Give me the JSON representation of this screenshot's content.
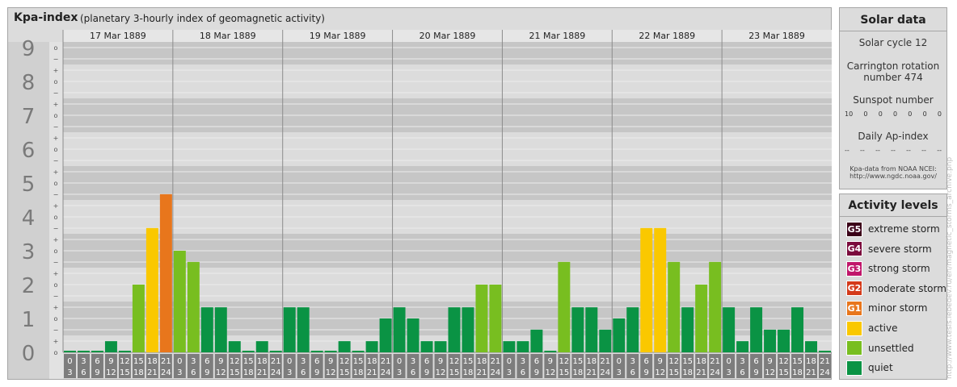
{
  "chart_data": {
    "type": "bar",
    "title": "Kpa-index",
    "subtitle": "(planetary 3-hourly index of geomagnetic activity)",
    "days": [
      "17 Mar 1889",
      "18 Mar 1889",
      "19 Mar 1889",
      "20 Mar 1889",
      "21 Mar 1889",
      "22 Mar 1889",
      "23 Mar 1889"
    ],
    "interval_starts": [
      "0",
      "3",
      "6",
      "9",
      "12",
      "15",
      "18",
      "21"
    ],
    "interval_ends": [
      "3",
      "6",
      "9",
      "12",
      "15",
      "18",
      "21",
      "24"
    ],
    "y_ticks": [
      "0",
      "1",
      "2",
      "3",
      "4",
      "5",
      "6",
      "7",
      "8",
      "9"
    ],
    "minor_marks": [
      "o",
      "+",
      "−"
    ],
    "ylim": [
      0,
      9.33
    ],
    "values": [
      [
        0.0,
        0.0,
        0.0,
        0.33,
        0.0,
        2.0,
        3.67,
        4.67
      ],
      [
        3.0,
        2.67,
        1.33,
        1.33,
        0.33,
        0.0,
        0.33,
        0.0
      ],
      [
        1.33,
        1.33,
        0.0,
        0.0,
        0.33,
        0.0,
        0.33,
        1.0
      ],
      [
        1.33,
        1.0,
        0.33,
        0.33,
        1.33,
        1.33,
        2.0,
        2.0
      ],
      [
        0.33,
        0.33,
        0.67,
        0.0,
        2.67,
        1.33,
        1.33,
        0.67
      ],
      [
        1.0,
        1.33,
        3.67,
        3.67,
        2.67,
        1.33,
        2.0,
        2.67
      ],
      [
        1.33,
        0.33,
        1.33,
        0.67,
        0.67,
        1.33,
        0.33,
        0.0
      ]
    ],
    "level_colors": {
      "quiet": "#0a9344",
      "unsettled": "#78be20",
      "active": "#fac800",
      "G1": "#e8761c",
      "G2": "#d43a1a",
      "G3": "#c0166a",
      "G4": "#7b0a3c",
      "G5": "#3b0018"
    }
  },
  "solar_data": {
    "title": "Solar data",
    "solar_cycle": "Solar cycle 12",
    "carrington_line1": "Carrington rotation",
    "carrington_line2": "number 474",
    "sunspot_label": "Sunspot number",
    "sunspot_values": [
      "10",
      "0",
      "0",
      "0",
      "0",
      "0",
      "0"
    ],
    "ap_label": "Daily Ap-index",
    "ap_values": [
      "--",
      "--",
      "--",
      "--",
      "--",
      "--",
      "--"
    ],
    "source_line1": "Kpa-data from NOAA NCEI:",
    "source_line2": "http://www.ngdc.noaa.gov/"
  },
  "activity_levels": {
    "title": "Activity levels",
    "items": [
      {
        "code": "G5",
        "label": "extreme storm",
        "color": "#3b0018"
      },
      {
        "code": "G4",
        "label": "severe storm",
        "color": "#7b0a3c"
      },
      {
        "code": "G3",
        "label": "strong storm",
        "color": "#c0166a"
      },
      {
        "code": "G2",
        "label": "moderate storm",
        "color": "#d43a1a"
      },
      {
        "code": "G1",
        "label": "minor storm",
        "color": "#e8761c"
      },
      {
        "code": "",
        "label": "active",
        "color": "#fac800"
      },
      {
        "code": "",
        "label": "unsettled",
        "color": "#78be20"
      },
      {
        "code": "",
        "label": "quiet",
        "color": "#0a9344"
      }
    ]
  },
  "watermark": "http://www.tesis.lebedev.ru/en/magnetic_storms_archive.php"
}
